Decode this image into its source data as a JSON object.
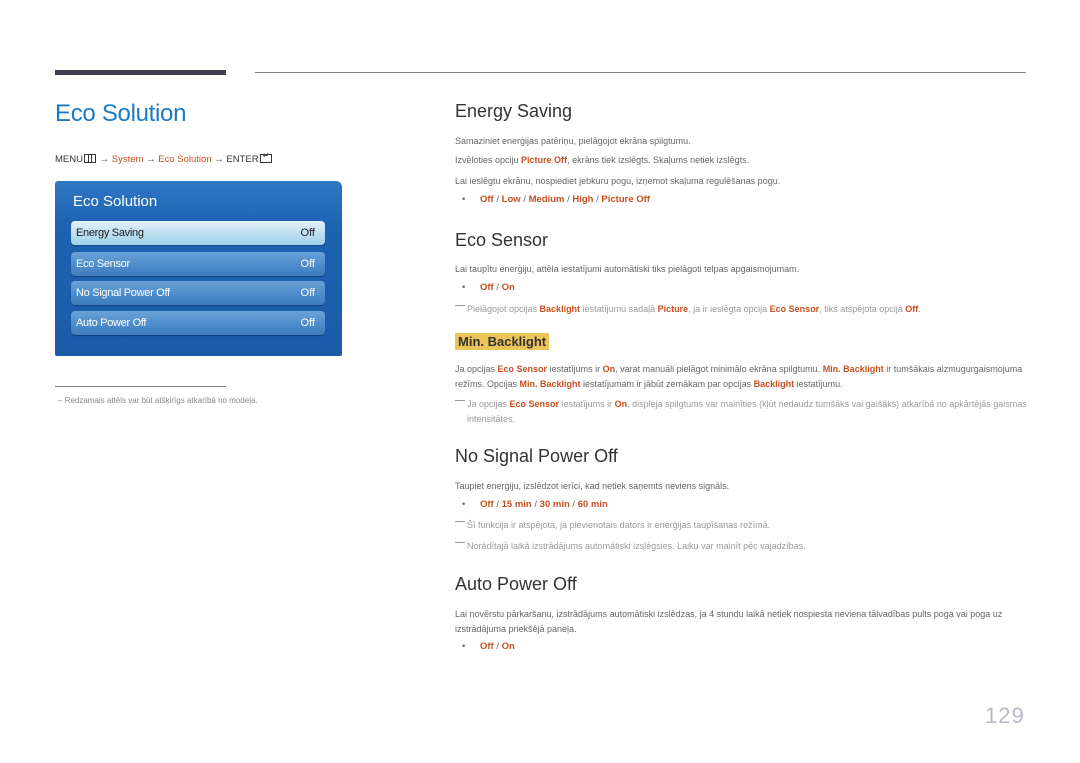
{
  "page": {
    "title": "Eco Solution",
    "number": "129"
  },
  "breadcrumb": {
    "menu": "MENU",
    "arrow": "→",
    "system": "System",
    "eco_solution": "Eco Solution",
    "enter": "ENTER"
  },
  "osd": {
    "title": "Eco Solution",
    "items": [
      {
        "label": "Energy Saving",
        "value": "Off",
        "selected": true
      },
      {
        "label": "Eco Sensor",
        "value": "Off",
        "selected": false
      },
      {
        "label": "No Signal Power Off",
        "value": "Off",
        "selected": false
      },
      {
        "label": "Auto Power Off",
        "value": "Off",
        "selected": false
      }
    ]
  },
  "footnote": "Redzamais attēls var būt atšķirīgs atkarībā no modeļa.",
  "sections": {
    "energy_saving": {
      "title": "Energy Saving",
      "p1": "Samaziniet enerģijas patēriņu, pielāgojot ekrāna spilgtumu.",
      "p2_pre": "Izvēloties opciju ",
      "p2_hl": "Picture Off",
      "p2_post": ", ekrāns tiek izslēgts. Skaļums netiek izslēgts.",
      "p3": "Lai ieslēgtu ekrānu, nospiediet jebkuru pogu, izņemot skaļuma regulēšanas pogu.",
      "options": [
        "Off",
        "Low",
        "Medium",
        "High",
        "Picture Off"
      ]
    },
    "eco_sensor": {
      "title": "Eco Sensor",
      "p1": "Lai taupītu enerģiju, attēla iestatījumi automātiski tiks pielāgoti telpas apgaismojumam.",
      "options": [
        "Off",
        "On"
      ],
      "note": {
        "t1": "Pielāgojot opcijas ",
        "h1": "Backlight",
        "t2": " iestatījumu sadaļā ",
        "h2": "Picture",
        "t3": ", ja ir ieslēgta opcija ",
        "h3": "Eco Sensor",
        "t4": ", tiks atspējota opcija ",
        "h4": "Off",
        "t5": "."
      }
    },
    "min_backlight": {
      "title": "Min. Backlight",
      "p": {
        "t1": "Ja opcijas ",
        "h1": "Eco Sensor",
        "t2": " iestatījums ir ",
        "h2": "On",
        "t3": ", varat manuāli pielāgot minimālo ekrāna spilgtumu. ",
        "h3": "Min. Backlight",
        "t4": " ir tumšākais aizmugurgaismojuma režīms. Opcijas ",
        "h4": "Min. Backlight",
        "t5": " iestatījumam ir jābūt zemākam par opcijas ",
        "h5": "Backlight",
        "t6": " iestatījumu."
      },
      "note": {
        "t1": "Ja opcijas ",
        "h1": "Eco Sensor",
        "t2": " iestatījums ir ",
        "h2": "On",
        "t3": ", displeja spilgtums var mainīties (kļūt nedaudz tumšāks vai gaišāks) atkarībā no apkārtējās gaismas intensitātes."
      }
    },
    "no_signal": {
      "title": "No Signal Power Off",
      "p1": "Taupiet enerģiju, izslēdzot ierīci, kad netiek saņemts neviens signāls.",
      "options": [
        "Off",
        "15 min",
        "30 min",
        "60 min"
      ],
      "note1": "Šī funkcija ir atspējota, ja pievienotais dators ir enerģijas taupīšanas režīmā.",
      "note2": "Norādītajā laikā izstrādājums automātiski izslēgsies. Laiku var mainīt pēc vajadzības."
    },
    "auto_power_off": {
      "title": "Auto Power Off",
      "p1": "Lai novērstu pārkaršanu, izstrādājums automātiski izslēdzas, ja 4 stundu laikā netiek nospiesta neviena tālvadības pults poga vai poga uz izstrādājuma priekšējā paneļa.",
      "options": [
        "Off",
        "On"
      ]
    }
  },
  "ui": {
    "bullet": "•",
    "separator": " / "
  },
  "colors": {
    "title_blue": "#1a7ac4",
    "highlight_orange": "#c85020",
    "subhead_bg": "#ecc45a",
    "osd_blue": "#1d63b2"
  }
}
